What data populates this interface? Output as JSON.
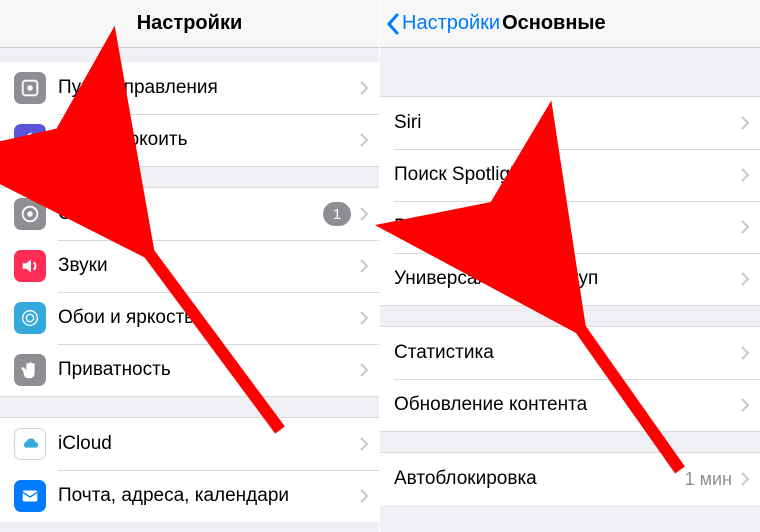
{
  "left": {
    "title": "Настройки",
    "groups": [
      {
        "rows": [
          {
            "icon": "control-center",
            "bg": "#8e8e93",
            "label": "Пункт управления"
          },
          {
            "icon": "moon",
            "bg": "#5856d6",
            "label": "Не беспокоить"
          }
        ]
      },
      {
        "rows": [
          {
            "icon": "gear",
            "bg": "#8e8e93",
            "label": "Основные",
            "badge": "1"
          },
          {
            "icon": "sound",
            "bg": "#ff2d55",
            "label": "Звуки"
          },
          {
            "icon": "wallpaper",
            "bg": "#34aadc",
            "label": "Обои и яркость"
          },
          {
            "icon": "hand",
            "bg": "#8e8e93",
            "label": "Приватность"
          }
        ]
      },
      {
        "rows": [
          {
            "icon": "cloud",
            "bg": "#ffffff",
            "label": "iCloud",
            "cloud": true
          },
          {
            "icon": "mail",
            "bg": "#007aff",
            "label": "Почта, адреса, календари"
          }
        ]
      }
    ]
  },
  "right": {
    "back": "Настройки",
    "title": "Основные",
    "groups": [
      {
        "rows": [
          {
            "label": "Siri"
          },
          {
            "label": "Поиск Spotlight"
          },
          {
            "label": "Размер текста"
          },
          {
            "label": "Универсальный доступ"
          }
        ]
      },
      {
        "rows": [
          {
            "label": "Статистика"
          },
          {
            "label": "Обновление контента"
          }
        ]
      },
      {
        "rows": [
          {
            "label": "Автоблокировка",
            "detail": "1 мин"
          }
        ]
      }
    ]
  }
}
